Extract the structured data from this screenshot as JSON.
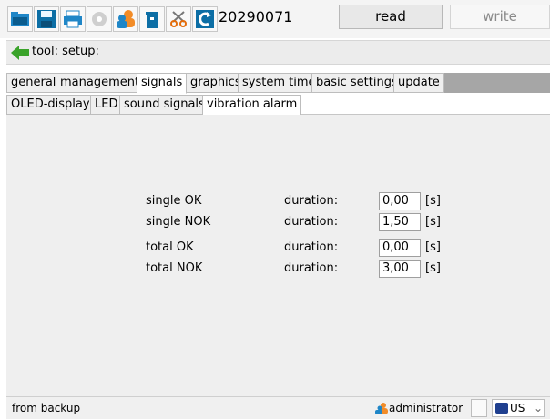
{
  "toolbar": {
    "device_id": "20290071",
    "read_label": "read",
    "write_label": "write",
    "icons": [
      "folder-open-icon",
      "save-icon",
      "print-icon",
      "settings-gear-icon",
      "users-icon",
      "trash-icon",
      "scissors-icon",
      "refresh-icon"
    ]
  },
  "breadcrumb": {
    "text": "tool: setup:"
  },
  "tabs_primary": [
    {
      "label": "general"
    },
    {
      "label": "management"
    },
    {
      "label": "signals",
      "active": true
    },
    {
      "label": "graphics"
    },
    {
      "label": "system time"
    },
    {
      "label": "basic settings"
    },
    {
      "label": "update"
    }
  ],
  "tabs_secondary": [
    {
      "label": "OLED-display"
    },
    {
      "label": "LED"
    },
    {
      "label": "sound signals"
    },
    {
      "label": "vibration alarm",
      "active": true
    }
  ],
  "signals": [
    {
      "label": "single OK",
      "duration_label": "duration:",
      "value": "0,00",
      "unit": "[s]"
    },
    {
      "label": "single NOK",
      "duration_label": "duration:",
      "value": "1,50",
      "unit": "[s]"
    },
    {
      "label": "total OK",
      "duration_label": "duration:",
      "value": "0,00",
      "unit": "[s]"
    },
    {
      "label": "total NOK",
      "duration_label": "duration:",
      "value": "3,00",
      "unit": "[s]"
    }
  ],
  "status": {
    "source_text": "from backup",
    "user": "administrator",
    "language": "US",
    "chevron": "⌄"
  },
  "colors": {
    "tab_bar": "#a6a6a6",
    "content_bg": "#efefef",
    "active_tab": "#ffffff"
  }
}
